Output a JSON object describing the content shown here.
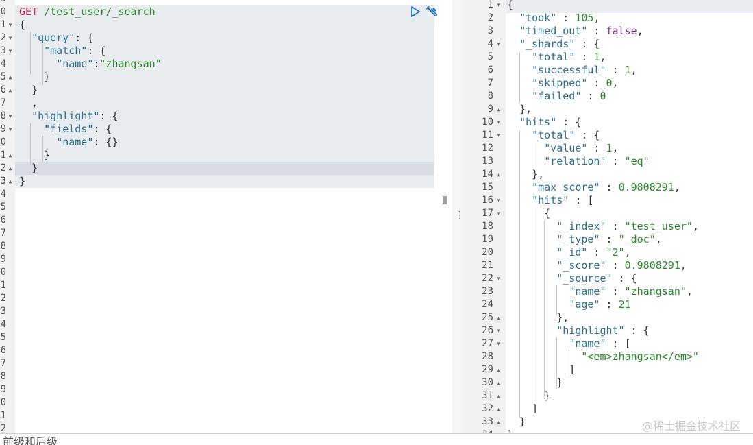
{
  "request": {
    "method": "GET",
    "path": "/test_user/_search",
    "lines": [
      "{",
      "  \"query\": {",
      "    \"match\": {",
      "      \"name\":\"zhangsan\"",
      "    }",
      "  }",
      "  ,",
      "  \"highlight\": {",
      "    \"fields\": {",
      "      \"name\": {}",
      "    }",
      "  }",
      "}"
    ],
    "gutter_numbers": [
      "5",
      "0",
      "1",
      "2",
      "3",
      "4",
      "5",
      "6",
      "7",
      "8",
      "9",
      "0",
      "1",
      "2",
      "3",
      "4",
      "5",
      "6",
      "7",
      "8",
      "9",
      "0",
      "1",
      "2",
      "3",
      "4",
      "5",
      "6",
      "7",
      "8",
      "9",
      "0",
      "1",
      "2"
    ]
  },
  "response": {
    "line_numbers": [
      "1",
      "2",
      "3",
      "4",
      "5",
      "6",
      "7",
      "8",
      "9",
      "10",
      "11",
      "12",
      "13",
      "14",
      "15",
      "16",
      "17",
      "18",
      "19",
      "20",
      "21",
      "22",
      "23",
      "24",
      "25",
      "26",
      "27",
      "28",
      "29",
      "30",
      "31",
      "32",
      "33",
      "34"
    ],
    "lines": [
      "{",
      "  \"took\" : 105,",
      "  \"timed_out\" : false,",
      "  \"_shards\" : {",
      "    \"total\" : 1,",
      "    \"successful\" : 1,",
      "    \"skipped\" : 0,",
      "    \"failed\" : 0",
      "  },",
      "  \"hits\" : {",
      "    \"total\" : {",
      "      \"value\" : 1,",
      "      \"relation\" : \"eq\"",
      "    },",
      "    \"max_score\" : 0.9808291,",
      "    \"hits\" : [",
      "      {",
      "        \"_index\" : \"test_user\",",
      "        \"_type\" : \"_doc\",",
      "        \"_id\" : \"2\",",
      "        \"_score\" : 0.9808291,",
      "        \"_source\" : {",
      "          \"name\" : \"zhangsan\",",
      "          \"age\" : 21",
      "        },",
      "        \"highlight\" : {",
      "          \"name\" : [",
      "            \"<em>zhangsan</em>\"",
      "          ]",
      "        }",
      "      }",
      "    ]",
      "  }",
      "}"
    ]
  },
  "toolbar": {
    "run_icon": "play-icon",
    "settings_icon": "wrench-icon"
  },
  "watermark": "@稀土掘金技术社区",
  "bottom_text": "前级和后级",
  "colors": {
    "method": "#c7254e",
    "key": "#2f6f8f",
    "string": "#2d8a2d",
    "boolean": "#7d2b91",
    "request_bg": "#e9ecef"
  }
}
